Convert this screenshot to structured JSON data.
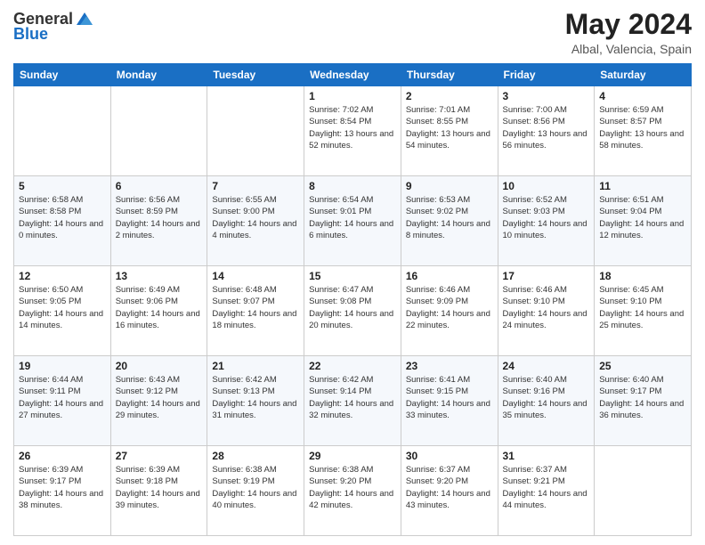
{
  "logo": {
    "general": "General",
    "blue": "Blue"
  },
  "title": "May 2024",
  "subtitle": "Albal, Valencia, Spain",
  "headers": [
    "Sunday",
    "Monday",
    "Tuesday",
    "Wednesday",
    "Thursday",
    "Friday",
    "Saturday"
  ],
  "weeks": [
    [
      {
        "day": "",
        "info": ""
      },
      {
        "day": "",
        "info": ""
      },
      {
        "day": "",
        "info": ""
      },
      {
        "day": "1",
        "info": "Sunrise: 7:02 AM\nSunset: 8:54 PM\nDaylight: 13 hours and 52 minutes."
      },
      {
        "day": "2",
        "info": "Sunrise: 7:01 AM\nSunset: 8:55 PM\nDaylight: 13 hours and 54 minutes."
      },
      {
        "day": "3",
        "info": "Sunrise: 7:00 AM\nSunset: 8:56 PM\nDaylight: 13 hours and 56 minutes."
      },
      {
        "day": "4",
        "info": "Sunrise: 6:59 AM\nSunset: 8:57 PM\nDaylight: 13 hours and 58 minutes."
      }
    ],
    [
      {
        "day": "5",
        "info": "Sunrise: 6:58 AM\nSunset: 8:58 PM\nDaylight: 14 hours and 0 minutes."
      },
      {
        "day": "6",
        "info": "Sunrise: 6:56 AM\nSunset: 8:59 PM\nDaylight: 14 hours and 2 minutes."
      },
      {
        "day": "7",
        "info": "Sunrise: 6:55 AM\nSunset: 9:00 PM\nDaylight: 14 hours and 4 minutes."
      },
      {
        "day": "8",
        "info": "Sunrise: 6:54 AM\nSunset: 9:01 PM\nDaylight: 14 hours and 6 minutes."
      },
      {
        "day": "9",
        "info": "Sunrise: 6:53 AM\nSunset: 9:02 PM\nDaylight: 14 hours and 8 minutes."
      },
      {
        "day": "10",
        "info": "Sunrise: 6:52 AM\nSunset: 9:03 PM\nDaylight: 14 hours and 10 minutes."
      },
      {
        "day": "11",
        "info": "Sunrise: 6:51 AM\nSunset: 9:04 PM\nDaylight: 14 hours and 12 minutes."
      }
    ],
    [
      {
        "day": "12",
        "info": "Sunrise: 6:50 AM\nSunset: 9:05 PM\nDaylight: 14 hours and 14 minutes."
      },
      {
        "day": "13",
        "info": "Sunrise: 6:49 AM\nSunset: 9:06 PM\nDaylight: 14 hours and 16 minutes."
      },
      {
        "day": "14",
        "info": "Sunrise: 6:48 AM\nSunset: 9:07 PM\nDaylight: 14 hours and 18 minutes."
      },
      {
        "day": "15",
        "info": "Sunrise: 6:47 AM\nSunset: 9:08 PM\nDaylight: 14 hours and 20 minutes."
      },
      {
        "day": "16",
        "info": "Sunrise: 6:46 AM\nSunset: 9:09 PM\nDaylight: 14 hours and 22 minutes."
      },
      {
        "day": "17",
        "info": "Sunrise: 6:46 AM\nSunset: 9:10 PM\nDaylight: 14 hours and 24 minutes."
      },
      {
        "day": "18",
        "info": "Sunrise: 6:45 AM\nSunset: 9:10 PM\nDaylight: 14 hours and 25 minutes."
      }
    ],
    [
      {
        "day": "19",
        "info": "Sunrise: 6:44 AM\nSunset: 9:11 PM\nDaylight: 14 hours and 27 minutes."
      },
      {
        "day": "20",
        "info": "Sunrise: 6:43 AM\nSunset: 9:12 PM\nDaylight: 14 hours and 29 minutes."
      },
      {
        "day": "21",
        "info": "Sunrise: 6:42 AM\nSunset: 9:13 PM\nDaylight: 14 hours and 31 minutes."
      },
      {
        "day": "22",
        "info": "Sunrise: 6:42 AM\nSunset: 9:14 PM\nDaylight: 14 hours and 32 minutes."
      },
      {
        "day": "23",
        "info": "Sunrise: 6:41 AM\nSunset: 9:15 PM\nDaylight: 14 hours and 33 minutes."
      },
      {
        "day": "24",
        "info": "Sunrise: 6:40 AM\nSunset: 9:16 PM\nDaylight: 14 hours and 35 minutes."
      },
      {
        "day": "25",
        "info": "Sunrise: 6:40 AM\nSunset: 9:17 PM\nDaylight: 14 hours and 36 minutes."
      }
    ],
    [
      {
        "day": "26",
        "info": "Sunrise: 6:39 AM\nSunset: 9:17 PM\nDaylight: 14 hours and 38 minutes."
      },
      {
        "day": "27",
        "info": "Sunrise: 6:39 AM\nSunset: 9:18 PM\nDaylight: 14 hours and 39 minutes."
      },
      {
        "day": "28",
        "info": "Sunrise: 6:38 AM\nSunset: 9:19 PM\nDaylight: 14 hours and 40 minutes."
      },
      {
        "day": "29",
        "info": "Sunrise: 6:38 AM\nSunset: 9:20 PM\nDaylight: 14 hours and 42 minutes."
      },
      {
        "day": "30",
        "info": "Sunrise: 6:37 AM\nSunset: 9:20 PM\nDaylight: 14 hours and 43 minutes."
      },
      {
        "day": "31",
        "info": "Sunrise: 6:37 AM\nSunset: 9:21 PM\nDaylight: 14 hours and 44 minutes."
      },
      {
        "day": "",
        "info": ""
      }
    ]
  ]
}
